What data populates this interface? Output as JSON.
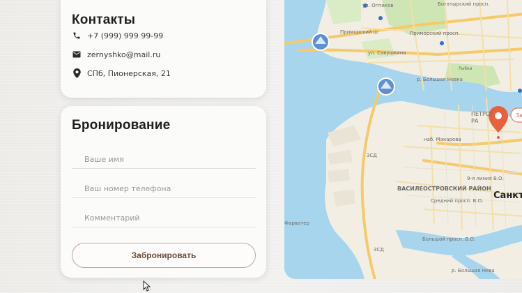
{
  "contacts": {
    "title": "Контакты",
    "phone": "+7 (999) 999 99-99",
    "email": "zernyshko@mail.ru",
    "address": "СПб, Пионерская, 21",
    "icons": {
      "phone": "phone-icon",
      "email": "mail-icon",
      "address": "location-pin-icon"
    }
  },
  "booking": {
    "title": "Бронирование",
    "name_placeholder": "Ваше имя",
    "phone_placeholder": "Ваш номер телефона",
    "comment_placeholder": "Комментарий",
    "submit_label": "Забронировать"
  },
  "map": {
    "labels": {
      "ul_optikov": "ул. Оптиков",
      "bogatyrsky": "Богатырский просп.",
      "primorsky": "Приморский ш",
      "primorsky2": "Приморский просп.",
      "savushkina": "ул. Савушкина",
      "bolshaya_nevka": "р. Большая Невка",
      "makarova": "наб. Макарова",
      "vasileostrovsky": "ВАСИЛЕОСТРОВСКИЙ РАЙОН",
      "zsd": "ЗСД",
      "zsd2": "ЗСД",
      "line": "9-я линия В.О.",
      "bolshoy": "Большой просп. В.О.",
      "sredniy": "Средний просп. В.О.",
      "fairway": "Фарватер",
      "petrograd": "ПЕТРОГ",
      "petrograd2": "РА",
      "sankt": "Санкт",
      "bolshaya_neva": "р. Большая Нева",
      "zm": "За",
      "park": "Рыбки"
    },
    "colors": {
      "water": "#a7d5ee",
      "land": "#f2eee3",
      "road": "#f6c969",
      "park": "#cde6b4",
      "pin": "#e8613d"
    }
  }
}
